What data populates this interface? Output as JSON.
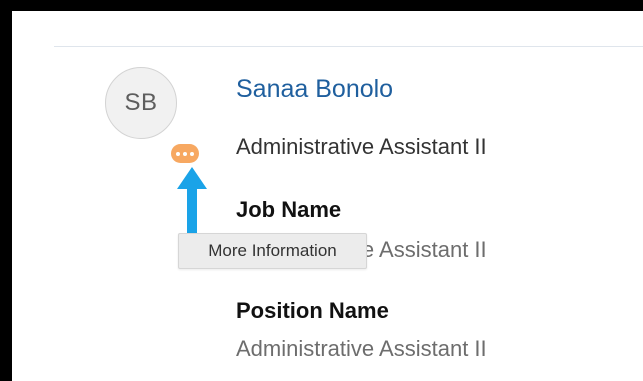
{
  "profile": {
    "initials": "SB",
    "name": "Sanaa Bonolo",
    "title": "Administrative Assistant II",
    "more_badge_color": "#f7a861",
    "name_color": "#1f5f9e"
  },
  "fields": {
    "job": {
      "label": "Job Name",
      "value": "Administrative Assistant II"
    },
    "position": {
      "label": "Position Name",
      "value": "Administrative Assistant II"
    }
  },
  "tooltip": {
    "text": "More Information"
  },
  "icons": {
    "more": "more-horizontal-icon",
    "pointer": "arrow-up-icon"
  },
  "annotation_color": "#1aa3e8"
}
